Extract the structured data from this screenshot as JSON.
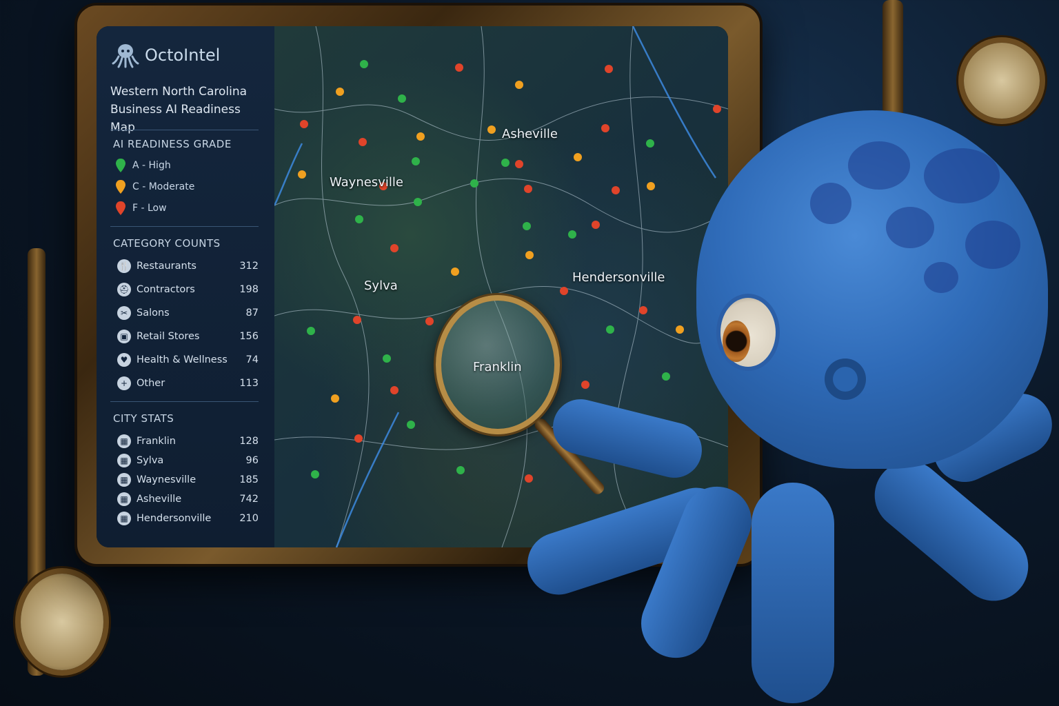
{
  "brand": {
    "name": "OctoIntel",
    "icon": "octopus-icon"
  },
  "title": {
    "line1": "Western North Carolina",
    "line2": "Business AI Readiness Map"
  },
  "legend": {
    "title": "AI READINESS GRADE",
    "items": [
      {
        "label": "A - High",
        "color": "#2fb24a"
      },
      {
        "label": "C - Moderate",
        "color": "#f0a020"
      },
      {
        "label": "F - Low",
        "color": "#e0442a"
      }
    ]
  },
  "categories": {
    "title": "CATEGORY COUNTS",
    "items": [
      {
        "label": "Restaurants",
        "count": "312",
        "icon": "utensils-icon"
      },
      {
        "label": "Contractors",
        "count": "198",
        "icon": "hardhat-icon"
      },
      {
        "label": "Salons",
        "count": "87",
        "icon": "scissors-icon"
      },
      {
        "label": "Retail Stores",
        "count": "156",
        "icon": "shopping-bag-icon"
      },
      {
        "label": "Health & Wellness",
        "count": "74",
        "icon": "heart-plus-icon"
      },
      {
        "label": "Other",
        "count": "113",
        "icon": "plus-icon"
      }
    ]
  },
  "cities": {
    "title": "CITY STATS",
    "items": [
      {
        "label": "Franklin",
        "count": "128",
        "icon": "city-icon"
      },
      {
        "label": "Sylva",
        "count": "96",
        "icon": "city-icon"
      },
      {
        "label": "Waynesville",
        "count": "185",
        "icon": "city-icon"
      },
      {
        "label": "Asheville",
        "count": "742",
        "icon": "city-icon"
      },
      {
        "label": "Hendersonville",
        "count": "210",
        "icon": "city-icon"
      }
    ]
  },
  "map": {
    "city_labels": [
      "Asheville",
      "Waynesville",
      "Sylva",
      "Hendersonville",
      "Franklin"
    ]
  }
}
